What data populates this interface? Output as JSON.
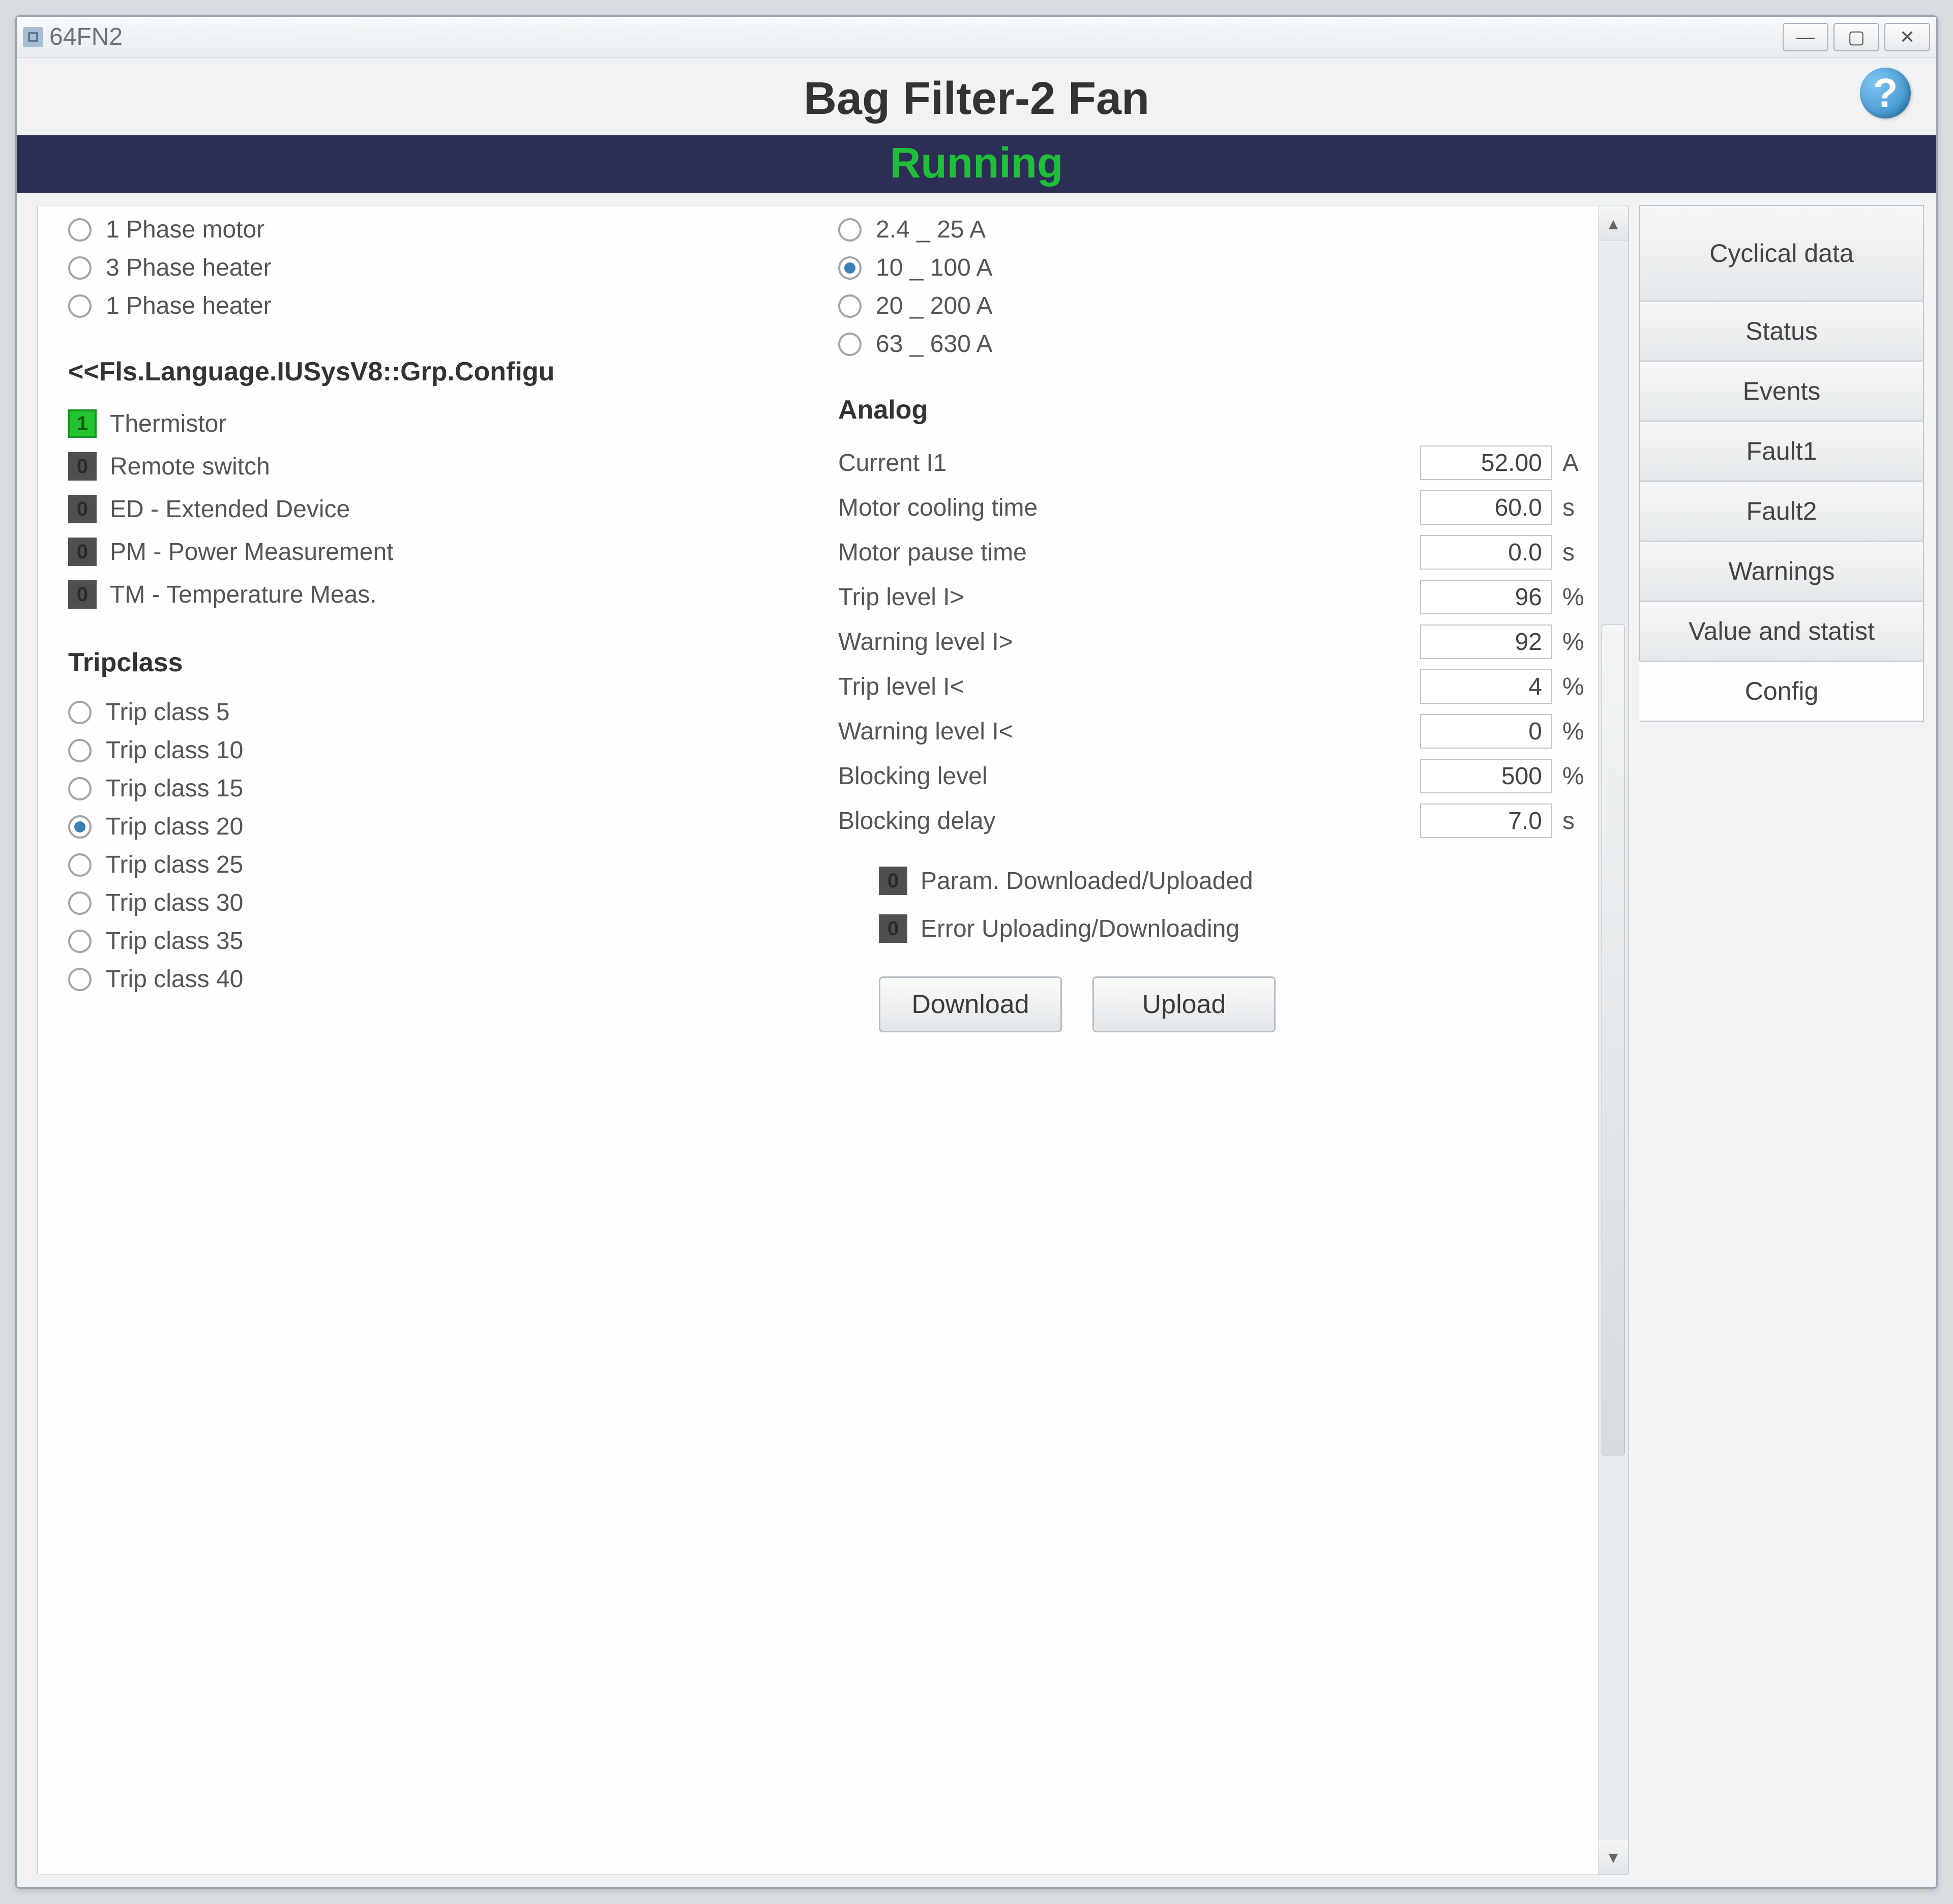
{
  "window": {
    "title": "64FN2"
  },
  "header": {
    "title": "Bag Filter-2 Fan"
  },
  "status": {
    "text": "Running"
  },
  "motor_type": {
    "opts": [
      "1 Phase motor",
      "3 Phase heater",
      "1 Phase heater"
    ],
    "selected": -1
  },
  "current_range": {
    "opts": [
      "2.4 _ 25 A",
      "10 _ 100 A",
      "20 _ 200 A",
      "63 _ 630 A"
    ],
    "selected": 1
  },
  "configu": {
    "title": "<<Fls.Language.IUSysV8::Grp.Configu",
    "items": [
      {
        "label": "Thermistor",
        "on": true
      },
      {
        "label": "Remote switch",
        "on": false
      },
      {
        "label": "ED - Extended Device",
        "on": false
      },
      {
        "label": "PM - Power Measurement",
        "on": false
      },
      {
        "label": "TM - Temperature Meas.",
        "on": false
      }
    ]
  },
  "tripclass": {
    "title": "Tripclass",
    "opts": [
      "Trip class 5",
      "Trip class 10",
      "Trip class 15",
      "Trip class 20",
      "Trip class 25",
      "Trip class 30",
      "Trip class 35",
      "Trip class 40"
    ],
    "selected": 3
  },
  "analog": {
    "title": "Analog",
    "rows": [
      {
        "label": "Current I1",
        "value": "52.00",
        "unit": "A"
      },
      {
        "label": "Motor cooling time",
        "value": "60.0",
        "unit": "s"
      },
      {
        "label": "Motor pause time",
        "value": "0.0",
        "unit": "s"
      },
      {
        "label": "Trip level I>",
        "value": "96",
        "unit": "%"
      },
      {
        "label": "Warning level I>",
        "value": "92",
        "unit": "%"
      },
      {
        "label": "Trip level I<",
        "value": "4",
        "unit": "%"
      },
      {
        "label": "Warning level I<",
        "value": "0",
        "unit": "%"
      },
      {
        "label": "Blocking level",
        "value": "500",
        "unit": "%"
      },
      {
        "label": "Blocking delay",
        "value": "7.0",
        "unit": "s"
      }
    ],
    "status": [
      {
        "label": "Param. Downloaded/Uploaded",
        "on": false
      },
      {
        "label": "Error Uploading/Downloading",
        "on": false
      }
    ],
    "buttons": {
      "download": "Download",
      "upload": "Upload"
    }
  },
  "tabs": {
    "items": [
      "Cyclical data",
      "Status",
      "Events",
      "Fault1",
      "Fault2",
      "Warnings",
      "Value and statist",
      "Config"
    ],
    "active": 7
  }
}
